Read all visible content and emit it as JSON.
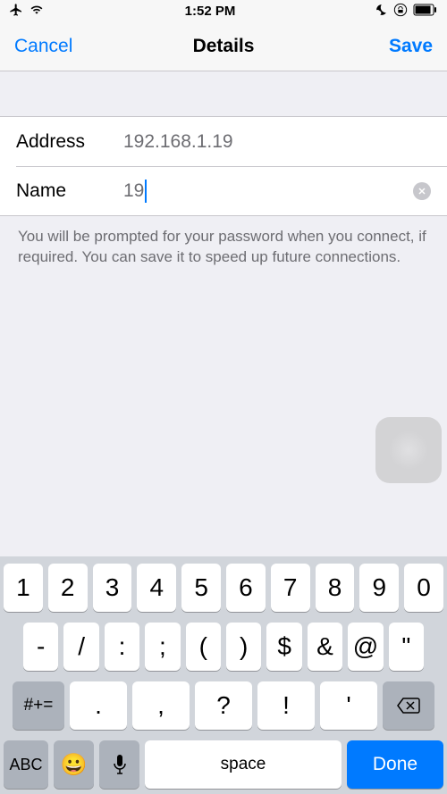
{
  "status": {
    "time": "1:52 PM"
  },
  "nav": {
    "cancel": "Cancel",
    "title": "Details",
    "save": "Save"
  },
  "form": {
    "address_label": "Address",
    "address_value": "192.168.1.19",
    "name_label": "Name",
    "name_value": "19"
  },
  "footer": "You will be prompted for your password when you connect, if required. You can save it to speed up future connections.",
  "keyboard": {
    "row1": [
      "1",
      "2",
      "3",
      "4",
      "5",
      "6",
      "7",
      "8",
      "9",
      "0"
    ],
    "row2": [
      "-",
      "/",
      ":",
      ";",
      "(",
      ")",
      "$",
      "&",
      "@",
      "\""
    ],
    "row3": [
      ".",
      ",",
      "?",
      "!",
      "'"
    ],
    "mode3": "#+=",
    "abc": "ABC",
    "space": "space",
    "done": "Done"
  }
}
